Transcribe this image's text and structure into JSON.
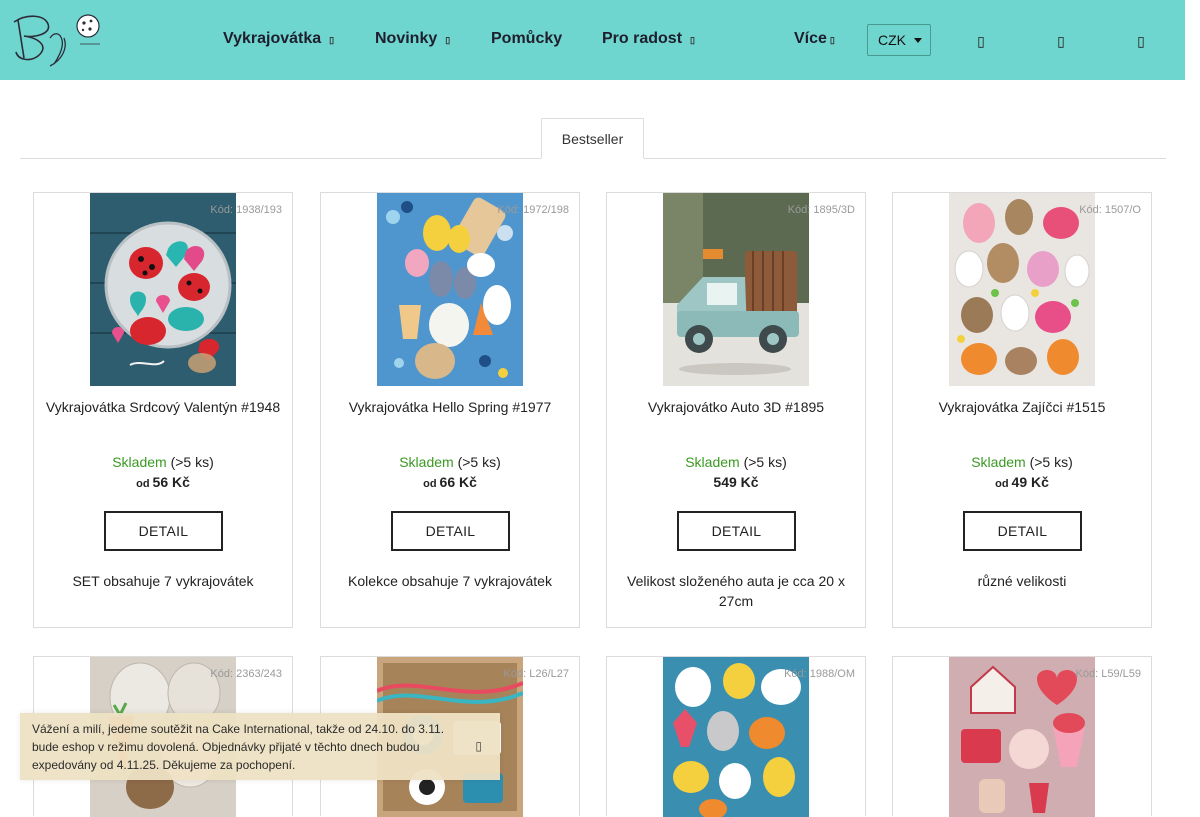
{
  "nav": {
    "items": [
      {
        "label": "Vykrajovátka",
        "has_caret": true
      },
      {
        "label": "Novinky",
        "has_caret": true
      },
      {
        "label": "Pomůcky",
        "has_caret": false
      },
      {
        "label": "Pro radost",
        "has_caret": true
      },
      {
        "label": "Více",
        "has_caret": true
      }
    ],
    "caret_glyph": "▯",
    "currency": "CZK",
    "icons": [
      "search-icon",
      "user-icon",
      "cart-icon"
    ],
    "icon_glyph": "▯"
  },
  "tabs": {
    "active": "Bestseller"
  },
  "products": [
    {
      "code": "Kód: 1938/193",
      "name": "Vykrajovátka Srdcový Valentýn #1948",
      "stock": "Skladem",
      "stock_qty": "(>5 ks)",
      "price_prefix": "od",
      "price": "56 Kč",
      "button": "DETAIL",
      "description": "SET obsahuje 7 vykrajovátek"
    },
    {
      "code": "Kód: 1972/198",
      "name": "Vykrajovátka Hello Spring #1977",
      "stock": "Skladem",
      "stock_qty": "(>5 ks)",
      "price_prefix": "od",
      "price": "66 Kč",
      "button": "DETAIL",
      "description": "Kolekce obsahuje 7 vykrajovátek"
    },
    {
      "code": "Kód: 1895/3D",
      "name": "Vykrajovátko Auto 3D #1895",
      "stock": "Skladem",
      "stock_qty": "(>5 ks)",
      "price_prefix": "",
      "price": "549 Kč",
      "button": "DETAIL",
      "description": "Velikost složeného auta je cca 20 x 27cm"
    },
    {
      "code": "Kód: 1507/O",
      "name": "Vykrajovátka Zajíčci #1515",
      "stock": "Skladem",
      "stock_qty": "(>5 ks)",
      "price_prefix": "od",
      "price": "49 Kč",
      "button": "DETAIL",
      "description": "různé velikosti"
    }
  ],
  "products_row2": [
    {
      "code": "Kód: 2363/243"
    },
    {
      "code": "Kód: L26/L27"
    },
    {
      "code": "Kód: 1988/OM"
    },
    {
      "code": "Kód: L59/L59"
    }
  ],
  "notice": {
    "text": "Vážení a milí, jedeme soutěžit na Cake International, takže od 24.10. do 3.11. bude eshop v režimu dovolená. Objednávky přijaté v těchto dnech budou expedovány od 4.11.25. Děkujeme za pochopení.",
    "close_glyph": "▯"
  },
  "colors": {
    "header": "#6fd6cf",
    "instock": "#3a9a22",
    "notice_bg": "#eee2c4"
  }
}
